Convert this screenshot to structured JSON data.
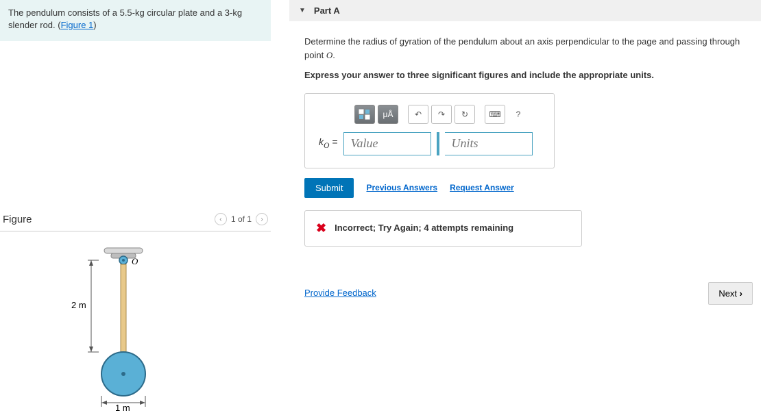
{
  "problem": {
    "text_prefix": "The pendulum consists of a 5.5-kg circular plate and a 3-kg slender rod. (",
    "figure_link": "Figure 1",
    "text_suffix": ")"
  },
  "figure": {
    "title": "Figure",
    "counter": "1 of 1",
    "dim_rod": "2 m",
    "dim_plate": "1 m",
    "point_label": "O"
  },
  "part": {
    "label": "Part A",
    "prompt1_prefix": "Determine the radius of gyration of the pendulum about an axis perpendicular to the page and passing through point ",
    "prompt1_var": "O",
    "prompt1_suffix": ".",
    "prompt2": "Express your answer to three significant figures and include the appropriate units.",
    "var_symbol": "k",
    "var_sub": "O",
    "equals": " = ",
    "value_placeholder": "Value",
    "units_placeholder": "Units",
    "toolbar": {
      "templates": "□",
      "units": "μÅ",
      "undo": "↶",
      "redo": "↷",
      "reset": "↻",
      "keyboard": "⌨",
      "help": "?"
    },
    "submit": "Submit",
    "prev_answers": "Previous Answers",
    "request_answer": "Request Answer",
    "feedback": "Incorrect; Try Again; 4 attempts remaining"
  },
  "footer": {
    "provide_feedback": "Provide Feedback",
    "next": "Next "
  }
}
